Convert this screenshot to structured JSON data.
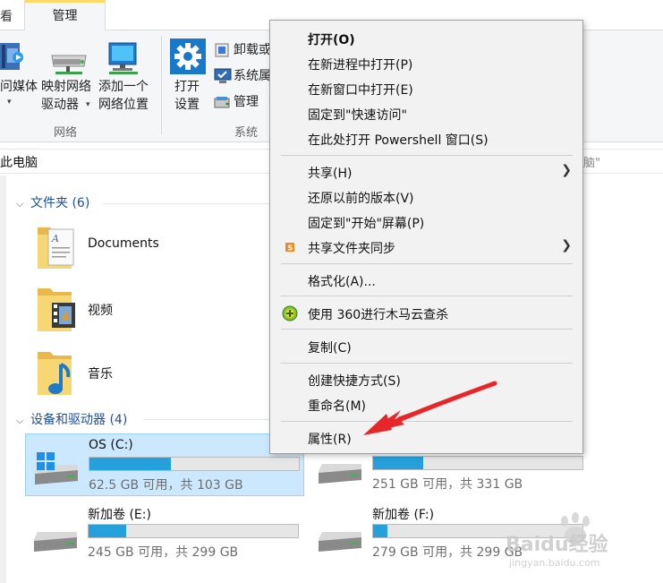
{
  "ribbon": {
    "tab_left": "看",
    "tab_manage": "管理",
    "media_label": "问媒体",
    "map_drive_line1": "映射网络",
    "map_drive_line2": "驱动器",
    "add_location_line1": "添加一个",
    "add_location_line2": "网络位置",
    "open_settings_line1": "打开",
    "open_settings_line2": "设置",
    "uninstall_label": "卸载或",
    "system_props_label": "系统属",
    "manage_label": "管理",
    "group_network": "网络",
    "group_system": "系统"
  },
  "address": {
    "path": "此电脑",
    "right_fragment": "脑\""
  },
  "sections": {
    "folders_header": "文件夹 (6)",
    "devices_header": "设备和驱动器 (4)"
  },
  "folders": [
    {
      "label": "Documents",
      "icon": "documents-folder-icon"
    },
    {
      "label": "视频",
      "icon": "videos-folder-icon"
    },
    {
      "label": "音乐",
      "icon": "music-folder-icon"
    }
  ],
  "drives": [
    {
      "name": "OS (C:)",
      "free": "62.5 GB 可用，共 103 GB",
      "used_fraction": 0.39,
      "selected": true
    },
    {
      "name": "",
      "free": "251 GB 可用，共 331 GB",
      "used_fraction": 0.24,
      "selected": false
    },
    {
      "name": "新加卷 (E:)",
      "free": "245 GB 可用，共 299 GB",
      "used_fraction": 0.18,
      "selected": false
    },
    {
      "name": "新加卷 (F:)",
      "free": "279 GB 可用，共 299 GB",
      "used_fraction": 0.07,
      "selected": false
    }
  ],
  "context_menu": {
    "items": [
      {
        "label": "打开(O)",
        "bold": true
      },
      {
        "label": "在新进程中打开(P)"
      },
      {
        "label": "在新窗口中打开(E)"
      },
      {
        "label": "固定到\"快速访问\""
      },
      {
        "label": "在此处打开 Powershell 窗口(S)"
      },
      {
        "label": "共享(H)",
        "submenu": true
      },
      {
        "label": "还原以前的版本(V)"
      },
      {
        "label": "固定到\"开始\"屏幕(P)"
      },
      {
        "label": "共享文件夹同步",
        "submenu": true,
        "icon": "sync-icon"
      },
      {
        "label": "格式化(A)..."
      },
      {
        "label": "使用 360进行木马云查杀",
        "icon": "360-scan-icon"
      },
      {
        "label": "复制(C)"
      },
      {
        "label": "创建快捷方式(S)"
      },
      {
        "label": "重命名(M)"
      },
      {
        "label": "属性(R)"
      }
    ],
    "submenu_arrow": "❯"
  },
  "watermark": {
    "brand": "Baidu经验",
    "url": "jingyan.baidu.com"
  },
  "colors": {
    "accent_blue": "#26a0da",
    "selection_bg": "#cce8ff",
    "arrow_red": "#e8262a"
  }
}
